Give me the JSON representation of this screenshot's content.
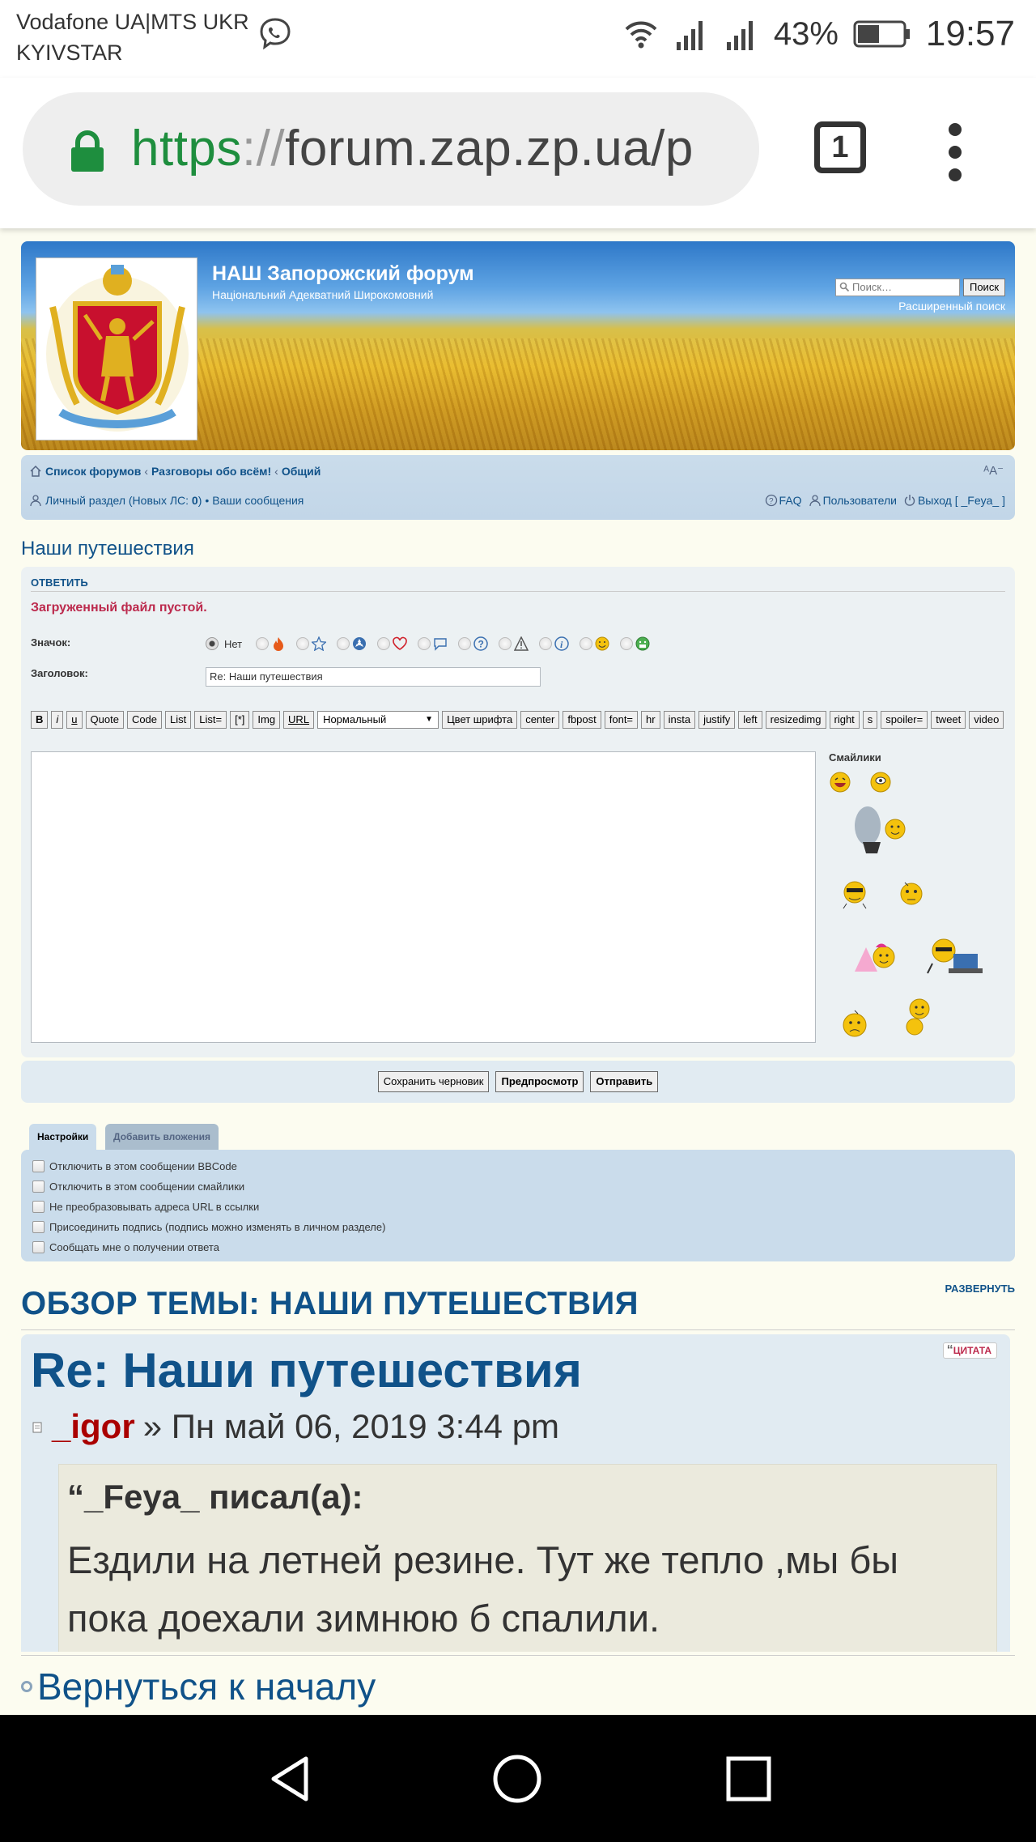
{
  "status_bar": {
    "carrier_line1": "Vodafone UA|MTS UKR",
    "carrier_line2": "KYIVSTAR",
    "battery": "43%",
    "time": "19:57"
  },
  "browser": {
    "url_scheme": "https",
    "url_sep": "://",
    "url_host": "forum.zap.zp.ua/p",
    "tab_count": "1"
  },
  "header": {
    "site_title": "НАШ Запорожский форум",
    "site_subtitle": "Національний Адекватний Широкомовний",
    "search_placeholder": "Поиск…",
    "search_button": "Поиск",
    "advanced_search": "Расширенный поиск"
  },
  "nav": {
    "crumbs": [
      "Список форумов",
      "Разговоры обо всём!",
      "Общий"
    ],
    "crumb_sep": "‹",
    "resize": "ᴬA⁻",
    "personal": "Личный раздел (Новых ЛС: ",
    "personal_count": "0",
    "personal_close": ")",
    "dot": " • ",
    "your_posts": "Ваши сообщения",
    "faq": "FAQ",
    "users": "Пользователи",
    "logout": "Выход [ _Feya_ ]"
  },
  "topic_title": "Наши путешествия",
  "post_form": {
    "reply_heading": "ОТВЕТИТЬ",
    "error": "Загруженный файл пустой.",
    "icon_label": "Значок:",
    "none_label": "Нет",
    "subject_label": "Заголовок:",
    "subject_value": "Re: Наши путешествия",
    "toolbar": [
      "B",
      "i",
      "u",
      "Quote",
      "Code",
      "List",
      "List=",
      "[*]",
      "Img",
      "URL"
    ],
    "font_size": "Нормальный",
    "toolbar2": [
      "Цвет шрифта",
      "center",
      "fbpost",
      "font=",
      "hr",
      "insta",
      "justify",
      "left",
      "resizedimg",
      "right",
      "s",
      "spoiler=",
      "tweet",
      "video"
    ],
    "smilies_heading": "Смайлики"
  },
  "buttons": {
    "save_draft": "Сохранить черновик",
    "preview": "Предпросмотр",
    "submit": "Отправить"
  },
  "options": {
    "tab_settings": "Настройки",
    "tab_attach": "Добавить вложения",
    "items": [
      "Отключить в этом сообщении BBCode",
      "Отключить в этом сообщении смайлики",
      "Не преобразовывать адреса URL в ссылки",
      "Присоединить подпись (подпись можно изменять в личном разделе)",
      "Сообщать мне о получении ответа"
    ]
  },
  "review": {
    "heading": "ОБЗОР ТЕМЫ: НАШИ ПУТЕШЕСТВИЯ",
    "expand": "РАЗВЕРНУТЬ",
    "quote_button": "ЦИТАТА",
    "post_title": "Re: Наши путешествия",
    "author": "_igor",
    "date": "» Пн май 06, 2019 3:44 pm",
    "quote_author": "_Feya_ писал(а):",
    "quote_text": "Ездили на летней резине. Тут же тепло ,мы бы пока доехали зимнюю б спалили."
  },
  "back_to_top": "Вернуться к началу"
}
